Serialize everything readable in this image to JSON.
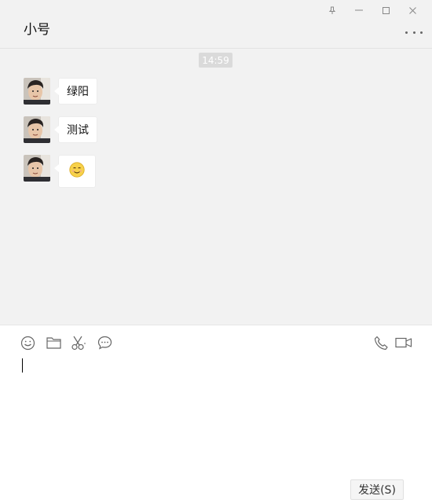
{
  "window": {
    "controls": [
      "pin-icon",
      "minimize-icon",
      "maximize-icon",
      "close-icon"
    ]
  },
  "header": {
    "title": "小号",
    "more_icon": "more-icon"
  },
  "messages": {
    "timestamp": "14:59",
    "items": [
      {
        "type": "text",
        "text": "绿阳"
      },
      {
        "type": "text",
        "text": "测试"
      },
      {
        "type": "emoji",
        "emoji": "smile-emoji"
      }
    ]
  },
  "input": {
    "toolbar_left": [
      "emoji-icon",
      "folder-icon",
      "scissors-icon",
      "chat-bubble-icon"
    ],
    "toolbar_right": [
      "phone-icon",
      "video-call-icon"
    ],
    "value": "",
    "send_label": "发送(S)"
  },
  "colors": {
    "background": "#f2f2f2",
    "bubble": "#ffffff",
    "timestamp_bg": "#dadada",
    "input_bg": "#ffffff"
  }
}
